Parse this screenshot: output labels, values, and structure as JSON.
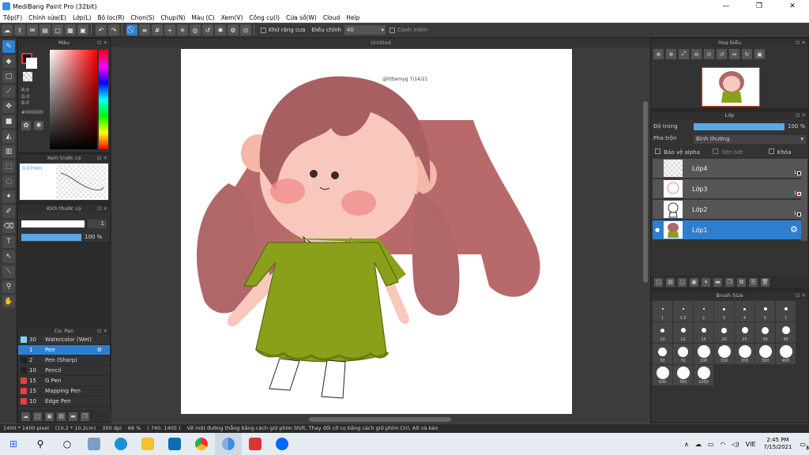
{
  "window": {
    "title": "MediBang Paint Pro (32bit)",
    "min": "—",
    "max": "❐",
    "close": "✕"
  },
  "menu": [
    "Tệp(F)",
    "Chỉnh sửa(E)",
    "Lớp(L)",
    "Bộ lọc(R)",
    "Chọn(S)",
    "Chụp(N)",
    "Màu (C)",
    "Xem(V)",
    "Công cụ(I)",
    "Cửa sổ(W)",
    "Cloud",
    "Help"
  ],
  "toolbar": {
    "antialias_label": "Khử răng cưa",
    "adjust_label": "Điều chỉnh",
    "adjust_value": "40",
    "snap_label": "Canh mềm"
  },
  "color_panel": {
    "title": "Màu",
    "r": "R:0",
    "g": "G:0",
    "b": "B:0",
    "hex": "#000000"
  },
  "preview_panel": {
    "title": "Xem trước cọ",
    "size": "0.07mm"
  },
  "brush_size_panel": {
    "title": "Kích thước cọ",
    "size_value": "1",
    "opacity": "100 %"
  },
  "brush_list": {
    "title": "Cọ: Pen",
    "items": [
      {
        "size": "30",
        "name": "Watercolor (Wet)",
        "color": "#7fd3f5"
      },
      {
        "size": "1",
        "name": "Pen",
        "color": "#2f7fd1"
      },
      {
        "size": "2",
        "name": "Pen (Sharp)",
        "color": "#222222"
      },
      {
        "size": "10",
        "name": "Pencil",
        "color": "#222222"
      },
      {
        "size": "15",
        "name": "G Pen",
        "color": "#e84040"
      },
      {
        "size": "15",
        "name": "Mapping Pen",
        "color": "#e84040"
      },
      {
        "size": "10",
        "name": "Edge Pen",
        "color": "#e84040"
      }
    ]
  },
  "canvas": {
    "tab": "Untitled",
    "signature": "@littlemyg 7/14/21"
  },
  "navigator": {
    "title": "Hoạ biểu"
  },
  "layers": {
    "title": "Lớp",
    "opacity_label": "Độ trong",
    "opacity_value": "100 %",
    "blend_label": "Pha trộn",
    "blend_value": "Bình thường",
    "protect_alpha": "Bảo vệ alpha",
    "clipping": "Xén bớt",
    "lock": "Khóa",
    "items": [
      {
        "name": "Lớp4",
        "level": "1"
      },
      {
        "name": "Lớp3",
        "level": "1"
      },
      {
        "name": "Lớp2",
        "level": "1"
      },
      {
        "name": "Lớp1",
        "level": "1"
      }
    ]
  },
  "brush_sizes": {
    "title": "Brush Size",
    "values": [
      "1",
      "1.5",
      "2",
      "3",
      "4",
      "5",
      "7",
      "10",
      "12",
      "15",
      "20",
      "25",
      "30",
      "40",
      "50",
      "70",
      "100",
      "150",
      "200",
      "300",
      "400",
      "500",
      "700",
      "1000"
    ]
  },
  "status": {
    "size": "1400 * 1400 pixel",
    "cm": "(10.2 * 10.2cm)",
    "dpi": "350 dpi",
    "zoom": "66 %",
    "coords": "( 740, 1405 )",
    "hint": "Vẽ một đường thẳng bằng cách giữ phím Shift, Thay đổi cỡ cọ bằng cách giữ phím Ctrl, Alt và kéo"
  },
  "taskbar": {
    "lang": "VIE",
    "time": "2:45 PM",
    "date": "7/15/2021",
    "notif": "3"
  }
}
